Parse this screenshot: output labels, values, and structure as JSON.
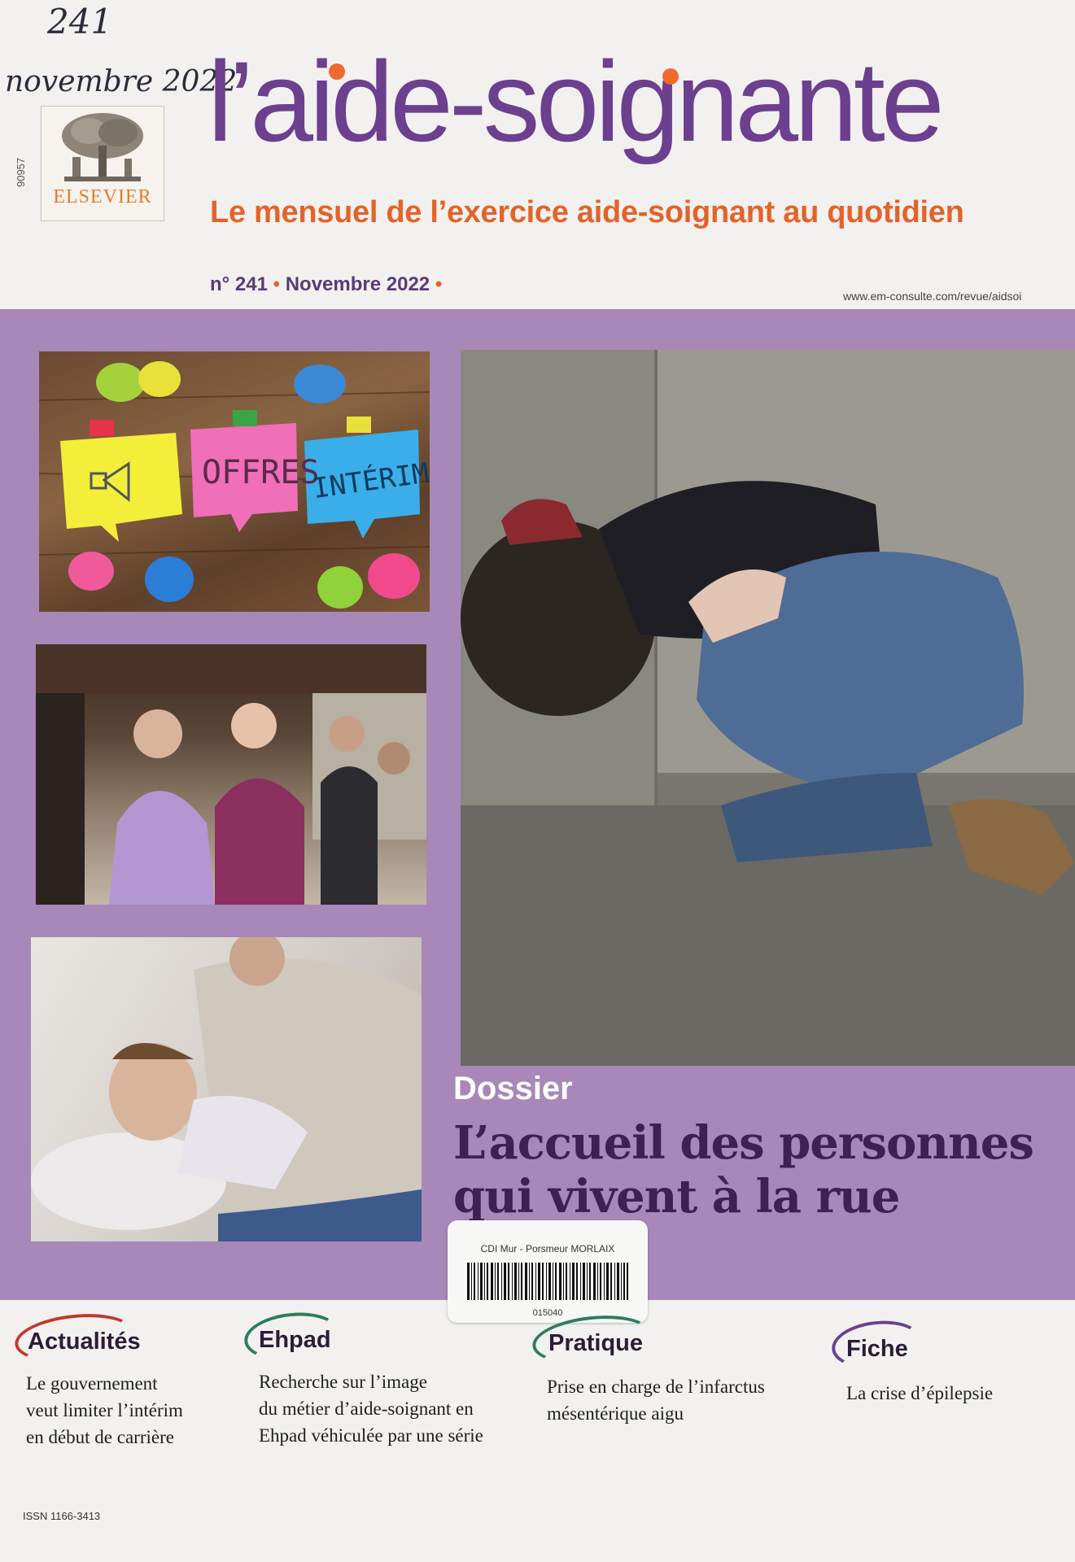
{
  "handwriting": {
    "issue": "241",
    "date": "novembre 2022"
  },
  "publisher": {
    "name": "ELSEVIER",
    "code": "90957"
  },
  "magazine": {
    "title": "l’aide-soignante",
    "subtitle": "Le mensuel de l’exercice aide-soignant au quotidien",
    "issue_number": "n° 241",
    "issue_date": "Novembre 2022",
    "url": "www.em-consulte.com/revue/aidsoi"
  },
  "photo_notes": {
    "note_1": "OFFRES",
    "note_2": "INTÉRIM"
  },
  "dossier": {
    "label": "Dossier",
    "title_line1": "L’accueil des personnes",
    "title_line2": "qui vivent à la rue"
  },
  "sticker": {
    "library": "CDI Mur - Porsmeur MORLAIX",
    "code": "015040"
  },
  "sections": [
    {
      "heading": "Actualités",
      "lines": [
        "Le gouvernement",
        "veut limiter l’intérim",
        "en début de carrière"
      ],
      "color": "#c0392b"
    },
    {
      "heading": "Ehpad",
      "lines": [
        "Recherche sur l’image",
        "du métier d’aide-soignant en",
        "Ehpad véhiculée par une série"
      ],
      "color": "#2e7d5b"
    },
    {
      "heading": "Pratique",
      "lines": [
        "Prise en charge de l’infarctus",
        "mésentérique aigu"
      ],
      "color": "#2e7d5b"
    },
    {
      "heading": "Fiche",
      "lines": [
        "La crise d’épilepsie"
      ],
      "color": "#6c3f8f"
    }
  ],
  "issn": "ISSN 1166-3413",
  "colors": {
    "brand_purple": "#6c3f8f",
    "brand_orange": "#e3632a",
    "band": "#a788b8"
  }
}
